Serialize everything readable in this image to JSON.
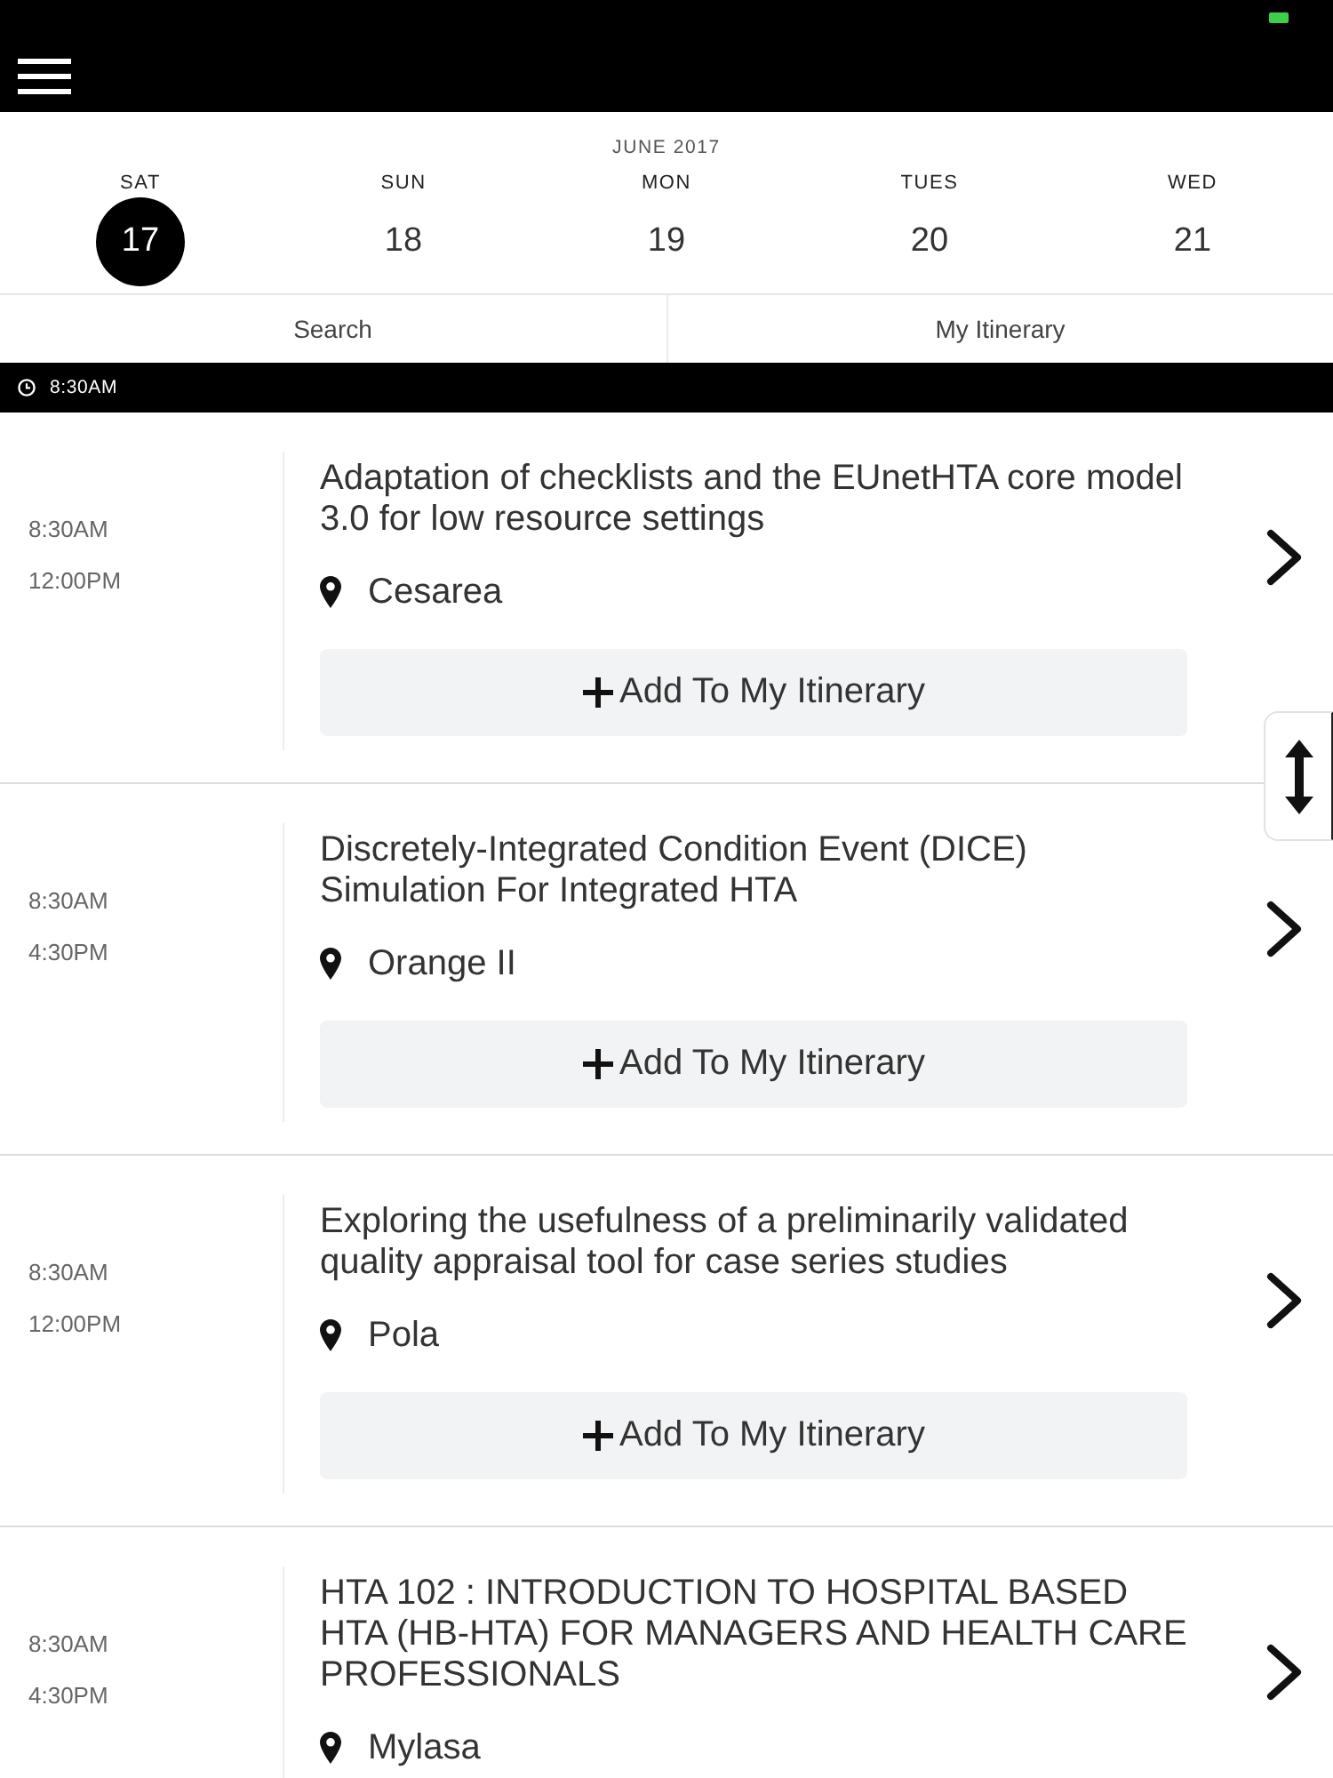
{
  "calendar": {
    "month": "JUNE 2017",
    "days": [
      {
        "weekday": "SAT",
        "date": "17",
        "selected": true
      },
      {
        "weekday": "SUN",
        "date": "18",
        "selected": false
      },
      {
        "weekday": "MON",
        "date": "19",
        "selected": false
      },
      {
        "weekday": "TUES",
        "date": "20",
        "selected": false
      },
      {
        "weekday": "WED",
        "date": "21",
        "selected": false
      }
    ]
  },
  "actions": [
    {
      "label": "Search"
    },
    {
      "label": "My Itinerary"
    }
  ],
  "time_header": "8:30AM",
  "sessions": [
    {
      "start": "8:30AM",
      "end": "12:00PM",
      "title": "Adaptation of checklists and the EUnetHTA core model 3.0 for low resource settings",
      "location": "Cesarea",
      "add_button": "Add To My Itinerary"
    },
    {
      "start": "8:30AM",
      "end": "4:30PM",
      "title": "Discretely-Integrated Condition Event (DICE) Simulation For Integrated HTA",
      "location": "Orange II",
      "add_button": "Add To My Itinerary"
    },
    {
      "start": "8:30AM",
      "end": "12:00PM",
      "title": "Exploring the usefulness of a preliminarily validated quality appraisal tool for case series studies",
      "location": "Pola",
      "add_button": "Add To My Itinerary"
    },
    {
      "start": "8:30AM",
      "end": "4:30PM",
      "title": "HTA 102 : INTRODUCTION TO HOSPITAL BASED HTA (HB-HTA) FOR MANAGERS AND HEALTH CARE PROFESSIONALS",
      "location": "Mylasa"
    }
  ]
}
